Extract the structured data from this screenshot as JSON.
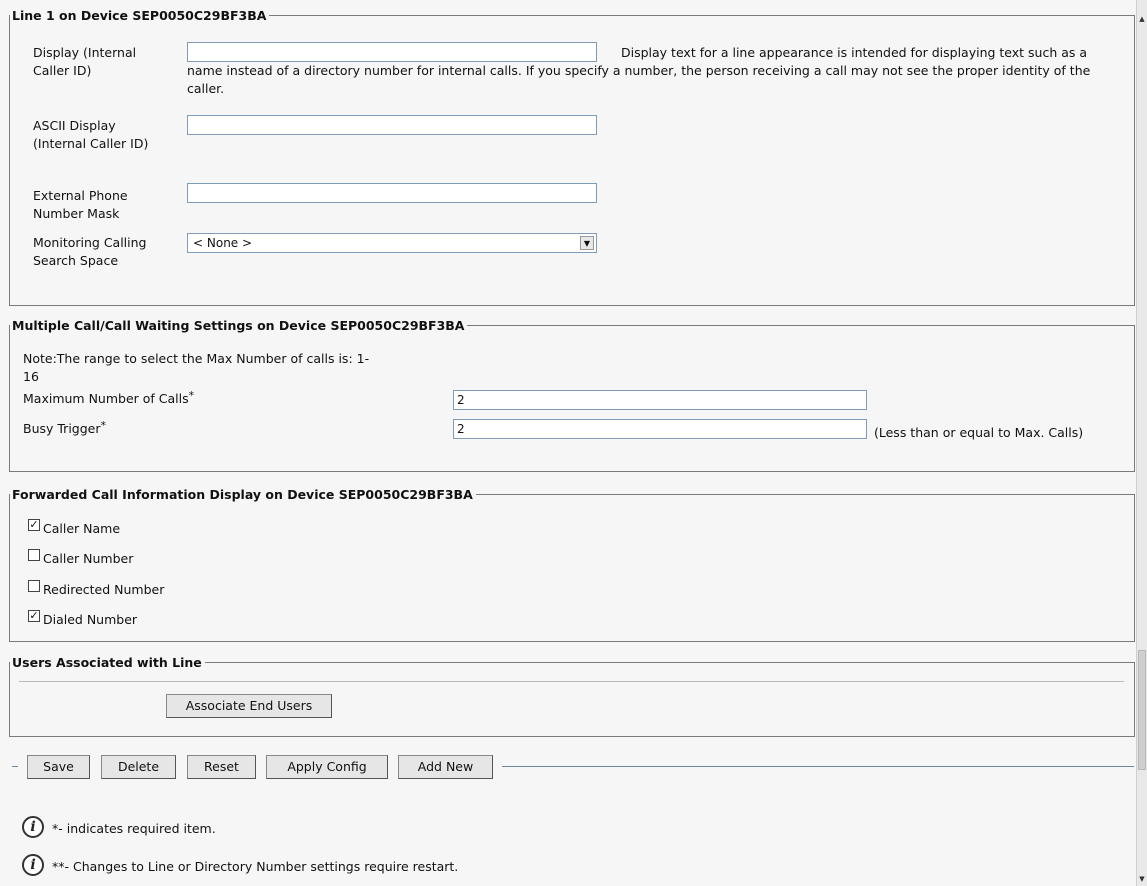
{
  "line_section": {
    "legend": "Line 1 on Device SEP0050C29BF3BA",
    "display_label": "Display (Internal Caller ID)",
    "display_value": "",
    "display_help": "Display text for a line appearance is intended for displaying text such as a name instead of a directory number for internal calls. If you specify a number, the person receiving a call may not see the proper identity of the caller.",
    "ascii_label": "ASCII Display (Internal Caller ID)",
    "ascii_value": "",
    "ext_mask_label": "External Phone Number Mask",
    "ext_mask_value": "",
    "monitoring_label": "Monitoring Calling Search Space",
    "monitoring_value": "< None >"
  },
  "multi_call_section": {
    "legend": "Multiple Call/Call Waiting Settings on Device SEP0050C29BF3BA",
    "note": "Note:The range to select the Max Number of calls is: 1-16",
    "max_calls_label": "Maximum Number of Calls",
    "max_calls_value": "2",
    "busy_trigger_label": "Busy Trigger",
    "busy_trigger_value": "2",
    "busy_trigger_hint": "(Less than or equal to Max. Calls)",
    "required_mark": "*"
  },
  "forwarded_section": {
    "legend": "Forwarded Call Information Display on Device SEP0050C29BF3BA",
    "options": [
      {
        "label": "Caller Name",
        "checked": true
      },
      {
        "label": "Caller Number",
        "checked": false
      },
      {
        "label": "Redirected Number",
        "checked": false
      },
      {
        "label": "Dialed Number",
        "checked": true
      }
    ]
  },
  "users_section": {
    "legend": "Users Associated with Line",
    "associate_button": "Associate End Users"
  },
  "toolbar": {
    "save": "Save",
    "delete": "Delete",
    "reset": "Reset",
    "apply_config": "Apply Config",
    "add_new": "Add New"
  },
  "notes": {
    "required": "*- indicates required item.",
    "restart": "**- Changes to Line or Directory Number settings require restart.",
    "icon": "i"
  },
  "colors": {
    "background": "#f6f6f6",
    "border": "#7a7a7a",
    "input_border": "#7f9db9",
    "button_bg": "#e6e6e6",
    "toolbar_line": "#6a8a9c"
  }
}
